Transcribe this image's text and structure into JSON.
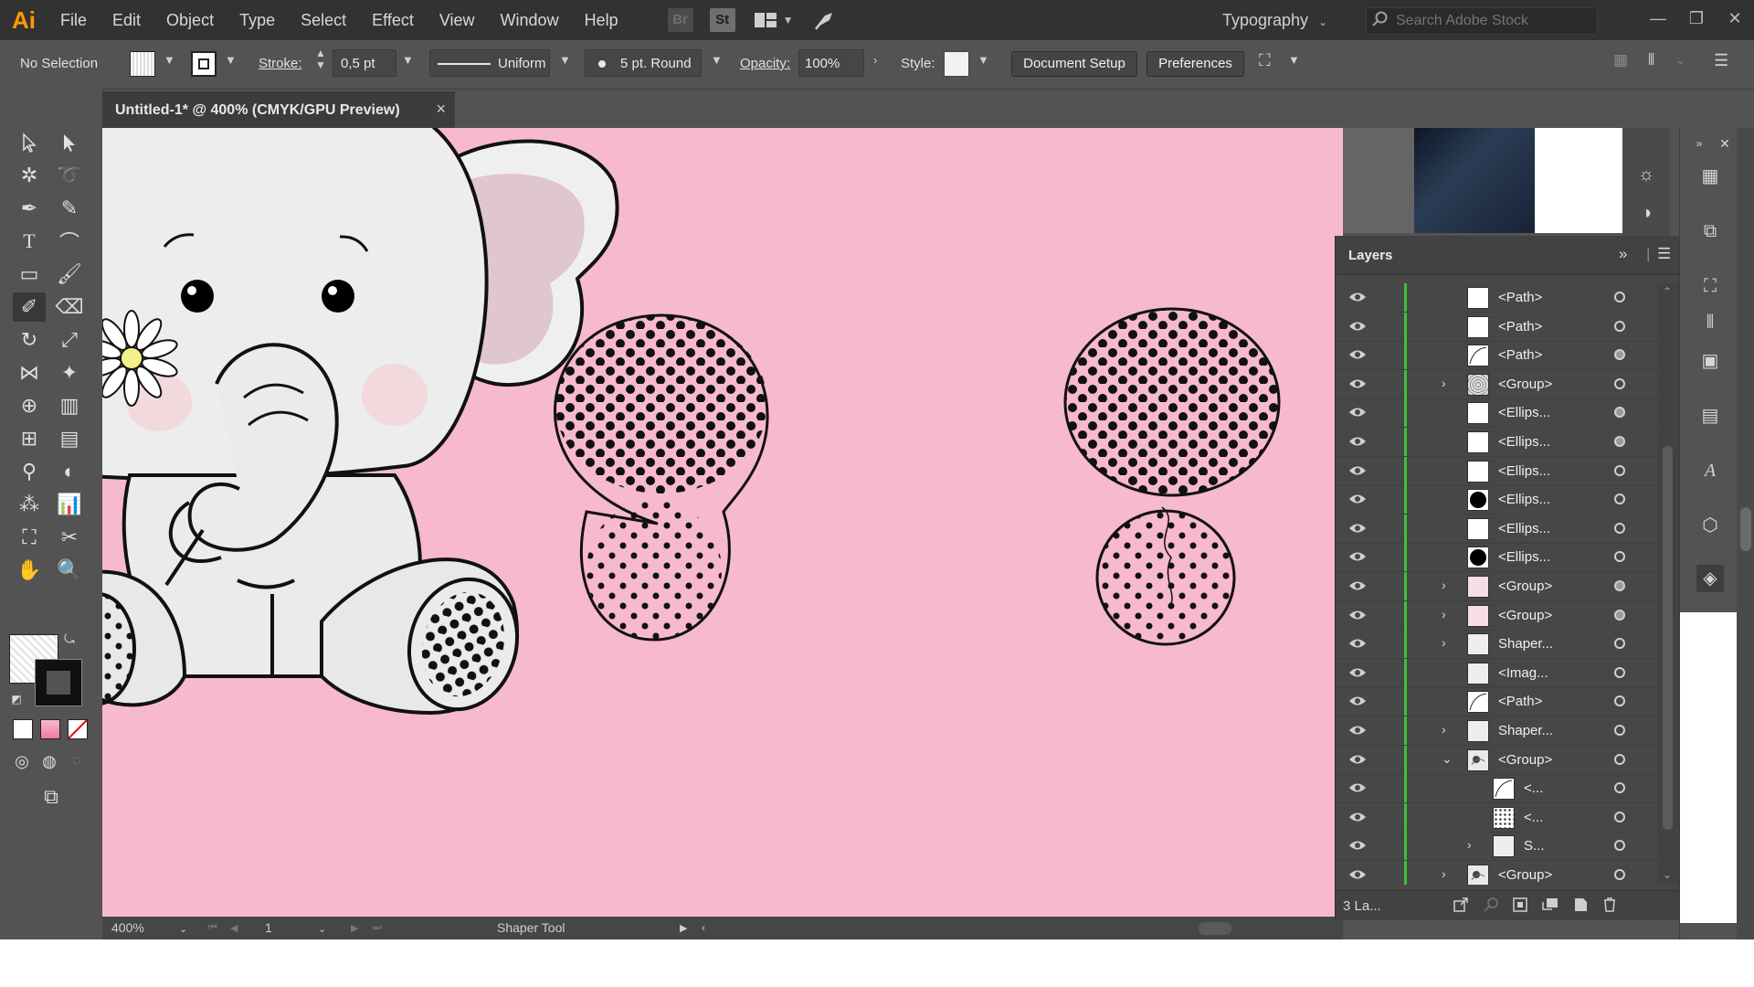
{
  "menubar": {
    "logo": "Ai",
    "items": [
      "File",
      "Edit",
      "Object",
      "Type",
      "Select",
      "Effect",
      "View",
      "Window",
      "Help"
    ],
    "bridge_label": "Br",
    "stock_label": "St",
    "workspace": "Typography",
    "search_placeholder": "Search Adobe Stock"
  },
  "control": {
    "selection": "No Selection",
    "stroke_label": "Stroke:",
    "stroke_value": "0,5 pt",
    "stroke_profile": "Uniform",
    "brush": "5 pt. Round",
    "opacity_label": "Opacity:",
    "opacity_value": "100%",
    "style_label": "Style:",
    "document_setup": "Document Setup",
    "preferences": "Preferences"
  },
  "document": {
    "tab_title": "Untitled-1* @ 400% (CMYK/GPU Preview)",
    "close_glyph": "×"
  },
  "status": {
    "zoom": "400%",
    "artboard": "1",
    "tool": "Shaper Tool"
  },
  "layers": {
    "title": "Layers",
    "footer_count": "3 La...",
    "rows": [
      {
        "label": "<Path>",
        "twist": "",
        "thumb": "white",
        "target": "hollow"
      },
      {
        "label": "<Path>",
        "twist": "",
        "thumb": "white",
        "target": "hollow"
      },
      {
        "label": "<Path>",
        "twist": "",
        "thumb": "curve",
        "target": "filled"
      },
      {
        "label": "<Group>",
        "twist": "›",
        "thumb": "pattern",
        "target": "hollow"
      },
      {
        "label": "<Ellips...",
        "twist": "",
        "thumb": "white",
        "target": "filled"
      },
      {
        "label": "<Ellips...",
        "twist": "",
        "thumb": "white",
        "target": "filled"
      },
      {
        "label": "<Ellips...",
        "twist": "",
        "thumb": "white",
        "target": "hollow"
      },
      {
        "label": "<Ellips...",
        "twist": "",
        "thumb": "black",
        "target": "hollow"
      },
      {
        "label": "<Ellips...",
        "twist": "",
        "thumb": "white",
        "target": "hollow"
      },
      {
        "label": "<Ellips...",
        "twist": "",
        "thumb": "black",
        "target": "hollow"
      },
      {
        "label": "<Group>",
        "twist": "›",
        "thumb": "pink",
        "target": "filled"
      },
      {
        "label": "<Group>",
        "twist": "›",
        "thumb": "pink",
        "target": "filled"
      },
      {
        "label": "Shaper...",
        "twist": "›",
        "thumb": "light",
        "target": "hollow"
      },
      {
        "label": "<Imag...",
        "twist": "",
        "thumb": "light",
        "target": "hollow"
      },
      {
        "label": "<Path>",
        "twist": "",
        "thumb": "curve",
        "target": "hollow"
      },
      {
        "label": "Shaper...",
        "twist": "›",
        "thumb": "light",
        "target": "hollow"
      },
      {
        "label": "<Group>",
        "twist": "⌄",
        "thumb": "sketch",
        "target": "hollow"
      },
      {
        "label": "<...",
        "twist": "",
        "thumb": "curve",
        "target": "hollow",
        "indent": 1
      },
      {
        "label": "<...",
        "twist": "",
        "thumb": "dots",
        "target": "hollow",
        "indent": 1
      },
      {
        "label": "S...",
        "twist": "›",
        "thumb": "light",
        "target": "hollow",
        "indent": 1
      },
      {
        "label": "<Group>",
        "twist": "›",
        "thumb": "sketch",
        "target": "hollow"
      }
    ]
  },
  "colors": {
    "canvas": "#f7b9cf",
    "chrome": "#535353",
    "menubar": "#323232",
    "layer_color": "#39c23a",
    "brand": "#ff9a00"
  }
}
